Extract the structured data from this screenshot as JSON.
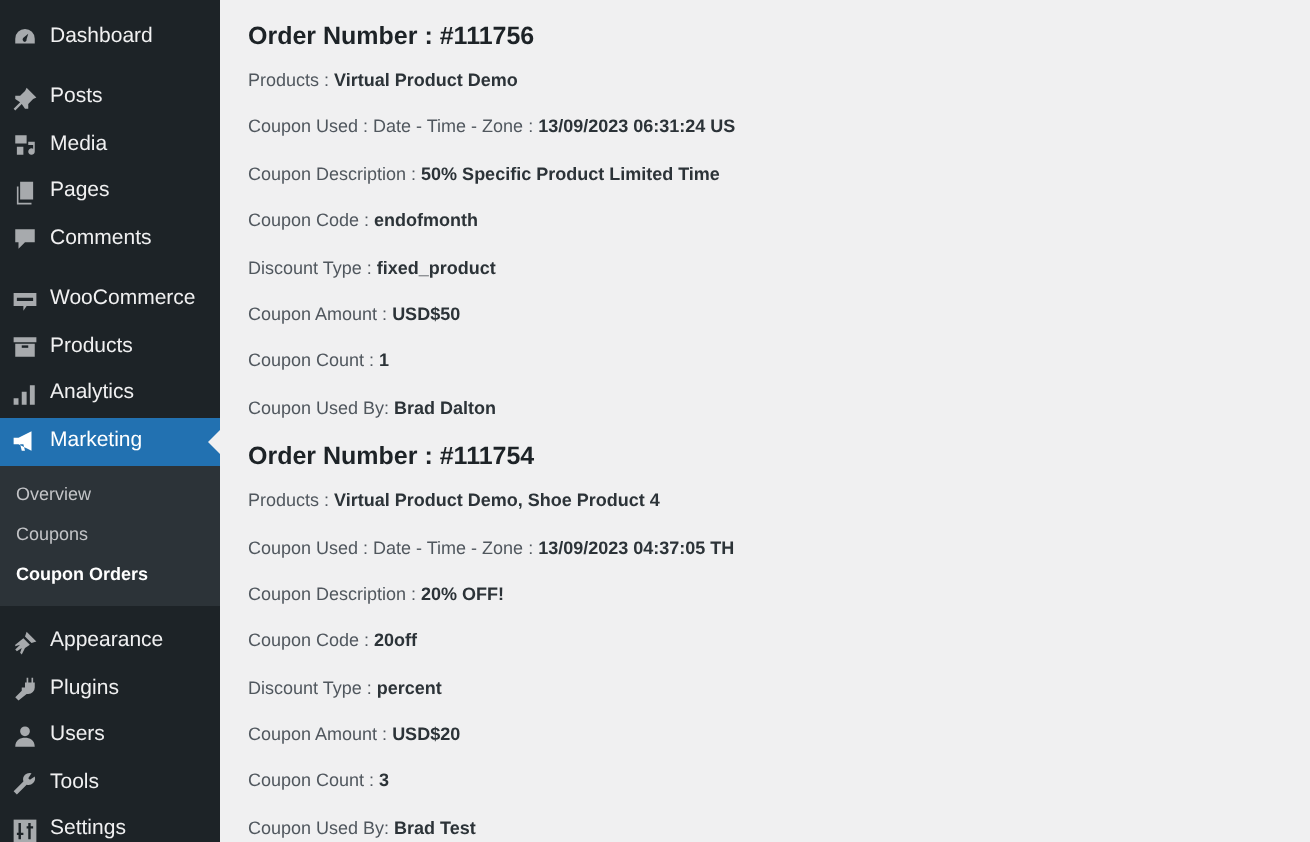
{
  "sidebar": {
    "groups": [
      {
        "items": [
          {
            "label": "Dashboard",
            "selected": false
          }
        ]
      },
      {
        "items": [
          {
            "label": "Posts",
            "selected": false
          },
          {
            "label": "Media",
            "selected": false
          },
          {
            "label": "Pages",
            "selected": false
          },
          {
            "label": "Comments",
            "selected": false
          }
        ]
      },
      {
        "items": [
          {
            "label": "WooCommerce",
            "selected": false
          },
          {
            "label": "Products",
            "selected": false
          },
          {
            "label": "Analytics",
            "selected": false
          },
          {
            "label": "Marketing",
            "selected": true,
            "submenu": [
              {
                "label": "Overview",
                "selected": false
              },
              {
                "label": "Coupons",
                "selected": false
              },
              {
                "label": "Coupon Orders",
                "selected": true
              }
            ]
          }
        ]
      },
      {
        "items": [
          {
            "label": "Appearance",
            "selected": false
          },
          {
            "label": "Plugins",
            "selected": false
          },
          {
            "label": "Users",
            "selected": false
          },
          {
            "label": "Tools",
            "selected": false
          },
          {
            "label": "Settings",
            "selected": false
          }
        ]
      }
    ]
  },
  "orders": [
    {
      "title": "Order Number : #111756",
      "fields": [
        {
          "label": "Products :",
          "value": "Virtual Product Demo"
        },
        {
          "label": "Coupon Used : Date - Time - Zone :",
          "value": "13/09/2023 06:31:24 US"
        },
        {
          "label": "Coupon Description :",
          "value": "50% Specific Product Limited Time"
        },
        {
          "label": "Coupon Code :",
          "value": "endofmonth"
        },
        {
          "label": "Discount Type :",
          "value": "fixed_product"
        },
        {
          "label": "Coupon Amount :",
          "value": "USD$50"
        },
        {
          "label": "Coupon Count :",
          "value": "1"
        },
        {
          "label": "Coupon Used By:",
          "value": "Brad Dalton"
        }
      ]
    },
    {
      "title": "Order Number : #111754",
      "fields": [
        {
          "label": "Products :",
          "value": "Virtual Product Demo, Shoe Product 4"
        },
        {
          "label": "Coupon Used : Date - Time - Zone :",
          "value": "13/09/2023 04:37:05 TH"
        },
        {
          "label": "Coupon Description :",
          "value": "20% OFF!"
        },
        {
          "label": "Coupon Code :",
          "value": "20off"
        },
        {
          "label": "Discount Type :",
          "value": "percent"
        },
        {
          "label": "Coupon Amount :",
          "value": "USD$20"
        },
        {
          "label": "Coupon Count :",
          "value": "3"
        },
        {
          "label": "Coupon Used By:",
          "value": "Brad Test"
        }
      ]
    }
  ]
}
